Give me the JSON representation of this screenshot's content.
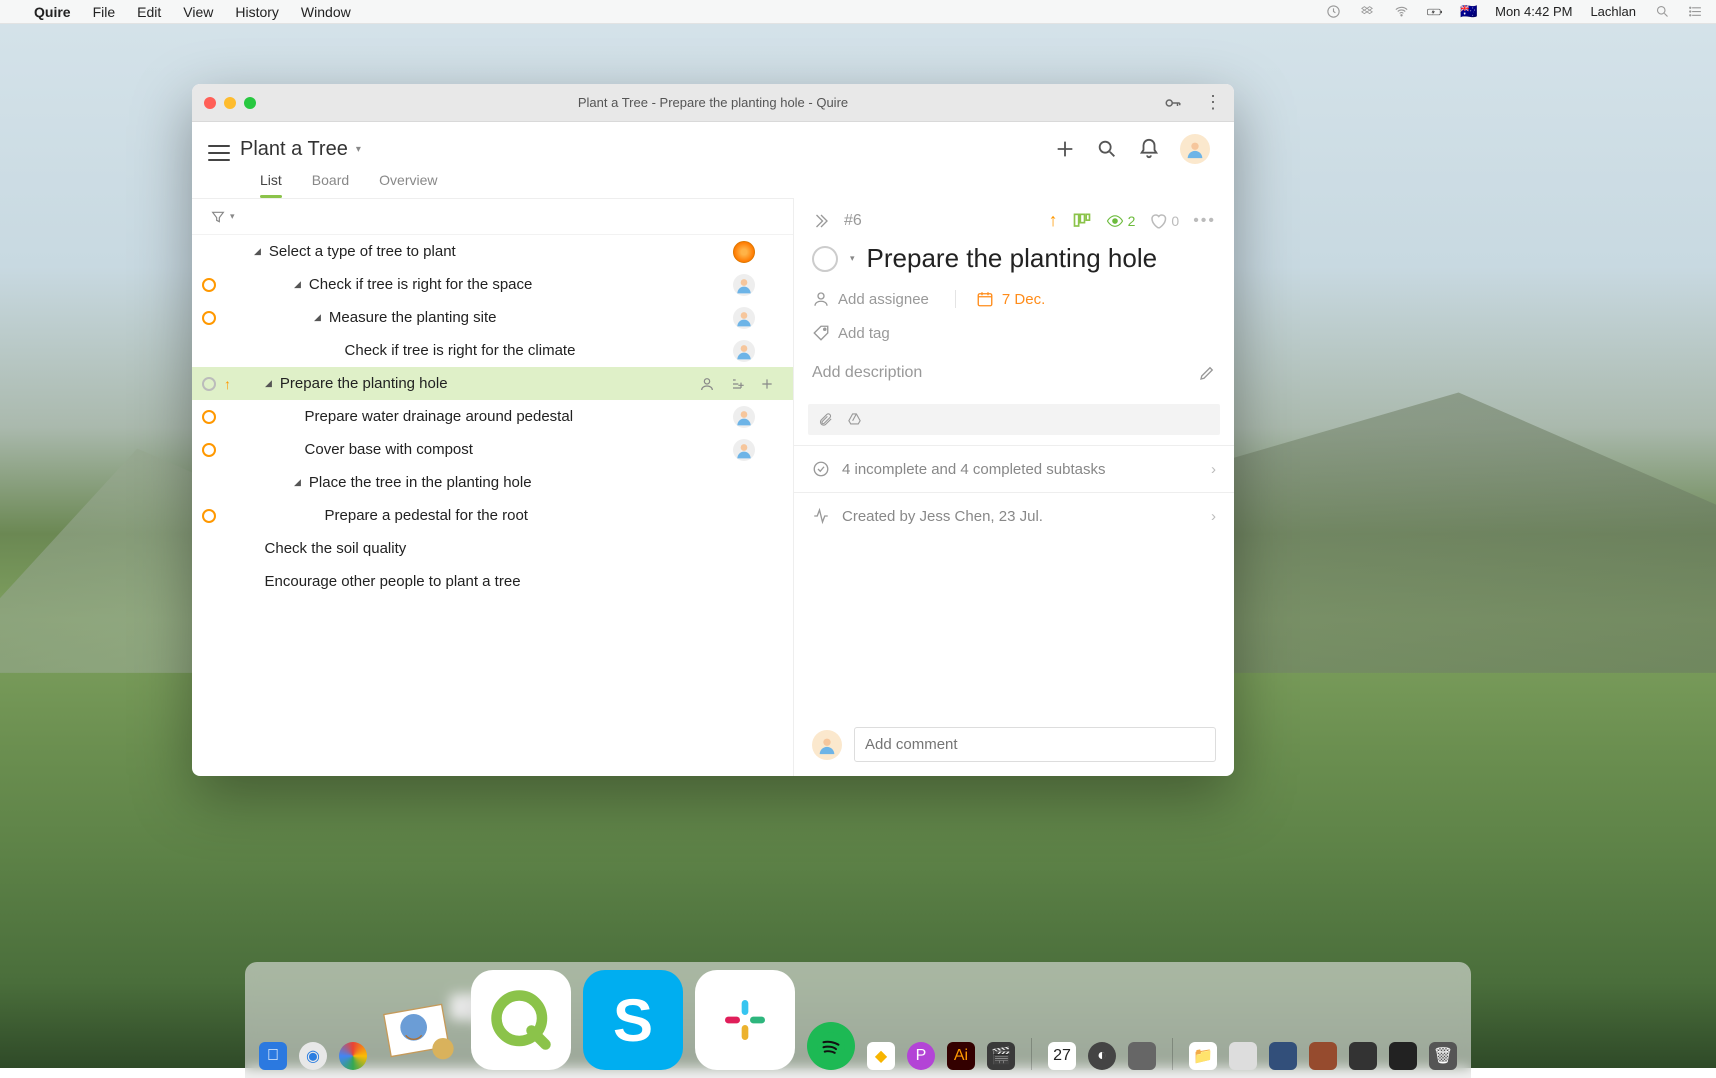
{
  "macbar": {
    "app": "Quire",
    "menus": [
      "File",
      "Edit",
      "View",
      "History",
      "Window"
    ],
    "time": "Mon 4:42 PM",
    "user": "Lachlan"
  },
  "window": {
    "title": "Plant a Tree - Prepare the planting hole - Quire"
  },
  "project": {
    "name": "Plant a Tree",
    "tabs": [
      "List",
      "Board",
      "Overview"
    ],
    "active_tab": "List"
  },
  "tasks": [
    {
      "indent": 0,
      "caret": true,
      "status": "",
      "text": "Select a type of tree to plant",
      "avatar": "badge"
    },
    {
      "indent": 1,
      "caret": true,
      "status": "orange",
      "text": "Check if tree is right for the space",
      "avatar": "person"
    },
    {
      "indent": 2,
      "caret": true,
      "status": "orange",
      "text": "Measure the planting site",
      "avatar": "person"
    },
    {
      "indent": 3,
      "caret": false,
      "status": "",
      "text": "Check if tree is right for the climate",
      "avatar": "person"
    },
    {
      "indent": 0,
      "caret": true,
      "status": "empty",
      "priority": true,
      "selected": true,
      "text": "Prepare the planting hole",
      "row_icons": true
    },
    {
      "indent": 1,
      "caret": false,
      "status": "orange",
      "text": "Prepare water drainage around pedestal",
      "avatar": "person"
    },
    {
      "indent": 1,
      "caret": false,
      "status": "orange",
      "text": "Cover base with compost",
      "avatar": "person"
    },
    {
      "indent": 1,
      "caret": true,
      "status": "",
      "text": "Place the tree in the planting hole"
    },
    {
      "indent": 2,
      "caret": false,
      "status": "orange",
      "text": "Prepare a pedestal for the root"
    },
    {
      "indent": 0,
      "caret": false,
      "status": "",
      "text": "Check the soil quality"
    },
    {
      "indent": 0,
      "caret": false,
      "status": "",
      "text": "Encourage other people to plant a tree"
    }
  ],
  "detail": {
    "id": "#6",
    "title": "Prepare the planting hole",
    "assignee_placeholder": "Add assignee",
    "date": "7 Dec.",
    "tag_placeholder": "Add tag",
    "desc_placeholder": "Add description",
    "watchers": "2",
    "likes": "0",
    "subtasks": "4 incomplete and 4 completed subtasks",
    "activity": "Created by Jess Chen, 23 Jul.",
    "comment_placeholder": "Add comment"
  },
  "dock": {
    "tooltip": "Quire",
    "calendar_day": "27"
  }
}
